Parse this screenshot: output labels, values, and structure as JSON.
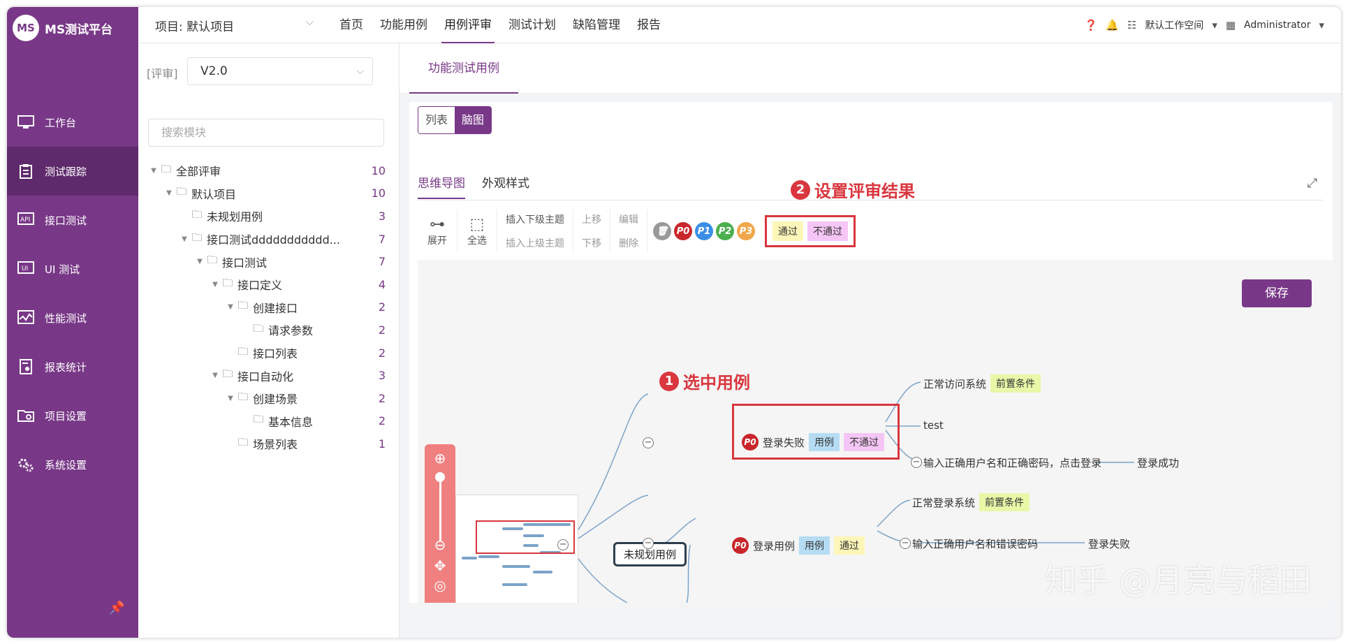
{
  "app": {
    "logo_text": "MS测试平台",
    "logo_badge": "MS"
  },
  "sidebar": {
    "items": [
      {
        "label": "工作台",
        "icon": "monitor-icon",
        "active": false
      },
      {
        "label": "测试跟踪",
        "icon": "clipboard-icon",
        "active": true
      },
      {
        "label": "接口测试",
        "icon": "api-icon",
        "active": false
      },
      {
        "label": "UI 测试",
        "icon": "ui-icon",
        "active": false
      },
      {
        "label": "性能测试",
        "icon": "performance-icon",
        "active": false
      },
      {
        "label": "报表统计",
        "icon": "report-icon",
        "active": false
      },
      {
        "label": "项目设置",
        "icon": "folder-settings-icon",
        "active": false
      },
      {
        "label": "系统设置",
        "icon": "gears-icon",
        "active": false
      }
    ]
  },
  "header": {
    "project_label": "项目: 默认项目",
    "nav": [
      "首页",
      "功能用例",
      "用例评审",
      "测试计划",
      "缺陷管理",
      "报告"
    ],
    "nav_active": 2,
    "workspace": "默认工作空间",
    "user": "Administrator"
  },
  "review": {
    "label": "[评审]",
    "version": "V2.0",
    "search_placeholder": "搜索模块"
  },
  "tree": [
    {
      "label": "全部评审",
      "count": "10",
      "depth": 0,
      "caret": true
    },
    {
      "label": "默认项目",
      "count": "10",
      "depth": 1,
      "caret": true
    },
    {
      "label": "未规划用例",
      "count": "3",
      "depth": 2,
      "caret": false
    },
    {
      "label": "接口测试ddddddddddd...",
      "count": "7",
      "depth": 2,
      "caret": true
    },
    {
      "label": "接口测试",
      "count": "7",
      "depth": 3,
      "caret": true
    },
    {
      "label": "接口定义",
      "count": "4",
      "depth": 4,
      "caret": true
    },
    {
      "label": "创建接口",
      "count": "2",
      "depth": 5,
      "caret": true
    },
    {
      "label": "请求参数",
      "count": "2",
      "depth": 6,
      "caret": false
    },
    {
      "label": "接口列表",
      "count": "2",
      "depth": 5,
      "caret": false
    },
    {
      "label": "接口自动化",
      "count": "3",
      "depth": 4,
      "caret": true
    },
    {
      "label": "创建场景",
      "count": "2",
      "depth": 5,
      "caret": true
    },
    {
      "label": "基本信息",
      "count": "2",
      "depth": 6,
      "caret": false
    },
    {
      "label": "场景列表",
      "count": "1",
      "depth": 5,
      "caret": false
    }
  ],
  "main": {
    "subtab": "功能测试用例",
    "view_list": "列表",
    "view_mind": "脑图",
    "mind_tabs": [
      "思维导图",
      "外观样式"
    ],
    "toolbar": {
      "expand": "展开",
      "select_all": "全选",
      "insert_child": "插入下级主题",
      "insert_parent": "插入上级主题",
      "move_up": "上移",
      "move_down": "下移",
      "edit": "编辑",
      "delete": "删除",
      "priorities": [
        "P0",
        "P1",
        "P2",
        "P3"
      ],
      "result_pass": "通过",
      "result_fail": "不通过"
    },
    "annotation_1": "选中用例",
    "annotation_2": "设置评审结果",
    "save": "保存"
  },
  "mindmap": {
    "root": "未规划用例",
    "case1": {
      "priority": "P0",
      "title": "登录失败",
      "type": "用例",
      "result": "不通过"
    },
    "case1_children": [
      "正常访问系统",
      "test",
      "输入正确用户名和正确密码，点击登录"
    ],
    "case1_pre": "前置条件",
    "case1_result_child": "登录成功",
    "case2": {
      "priority": "P0",
      "title": "登录用例",
      "type": "用例",
      "result": "通过"
    },
    "case2_children": [
      "正常登录系统",
      "输入正确用户名和错误密码"
    ],
    "case2_pre": "前置条件",
    "case2_result_child": "登录失败"
  },
  "watermark": "知乎 @月亮与稻田",
  "colors": {
    "brand": "#783887",
    "brand_dark": "#5e2a6b",
    "annotation": "#d9363e",
    "p0": "#c9262b",
    "p1": "#3a8ee6",
    "p2": "#4caf50",
    "p3": "#f0a64a"
  }
}
